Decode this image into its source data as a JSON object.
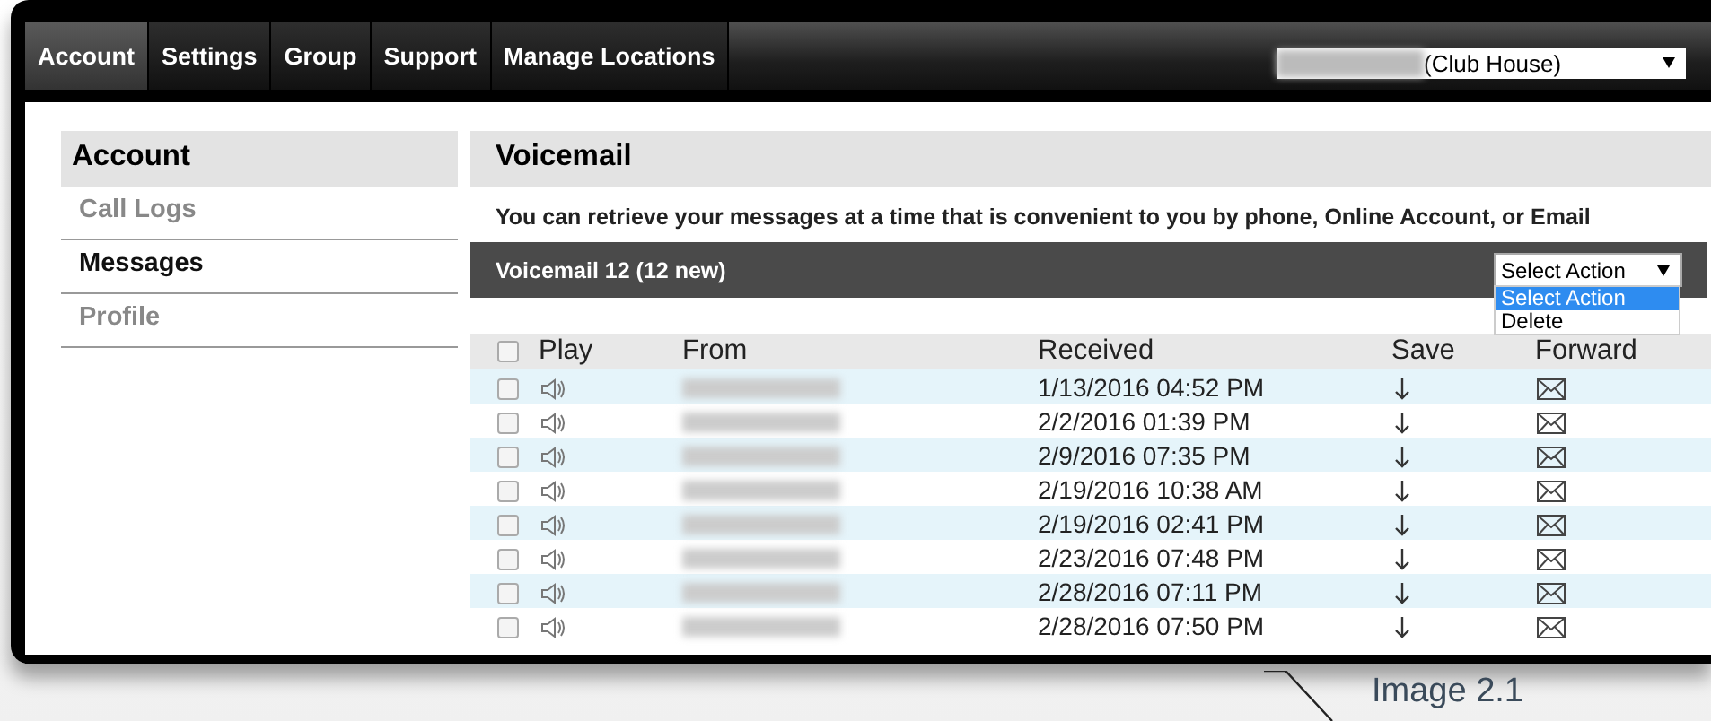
{
  "tabs": [
    {
      "label": "Account",
      "selected": true
    },
    {
      "label": "Settings",
      "selected": false
    },
    {
      "label": "Group",
      "selected": false
    },
    {
      "label": "Support",
      "selected": false
    },
    {
      "label": "Manage Locations",
      "selected": false
    }
  ],
  "location_select": {
    "value": "(Club House)"
  },
  "sidebar": {
    "title": "Account",
    "items": [
      {
        "label": "Call Logs",
        "selected": false
      },
      {
        "label": "Messages",
        "selected": true
      },
      {
        "label": "Profile",
        "selected": false
      }
    ]
  },
  "main": {
    "title": "Voicemail",
    "description": "You can retrieve your messages at a time that is convenient to you by phone, Online Account, or Email",
    "bar_title": "Voicemail 12 (12 new)",
    "action_select": {
      "value": "Select Action",
      "expanded": true,
      "options": [
        {
          "label": "Select Action",
          "selected": true
        },
        {
          "label": "Delete",
          "selected": false
        }
      ]
    }
  },
  "table": {
    "select_all_checked": false,
    "columns": [
      "Play",
      "From",
      "Received",
      "Save",
      "Forward"
    ],
    "rows": [
      {
        "checked": false,
        "received": "1/13/2016 04:52 PM"
      },
      {
        "checked": false,
        "received": "2/2/2016 01:39 PM"
      },
      {
        "checked": false,
        "received": "2/9/2016 07:35 PM"
      },
      {
        "checked": false,
        "received": "2/19/2016 10:38 AM"
      },
      {
        "checked": false,
        "received": "2/19/2016 02:41 PM"
      },
      {
        "checked": false,
        "received": "2/23/2016 07:48 PM"
      },
      {
        "checked": false,
        "received": "2/28/2016 07:11 PM"
      },
      {
        "checked": false,
        "received": "2/28/2016 07:50 PM"
      }
    ]
  },
  "caption": "Image 2.1"
}
